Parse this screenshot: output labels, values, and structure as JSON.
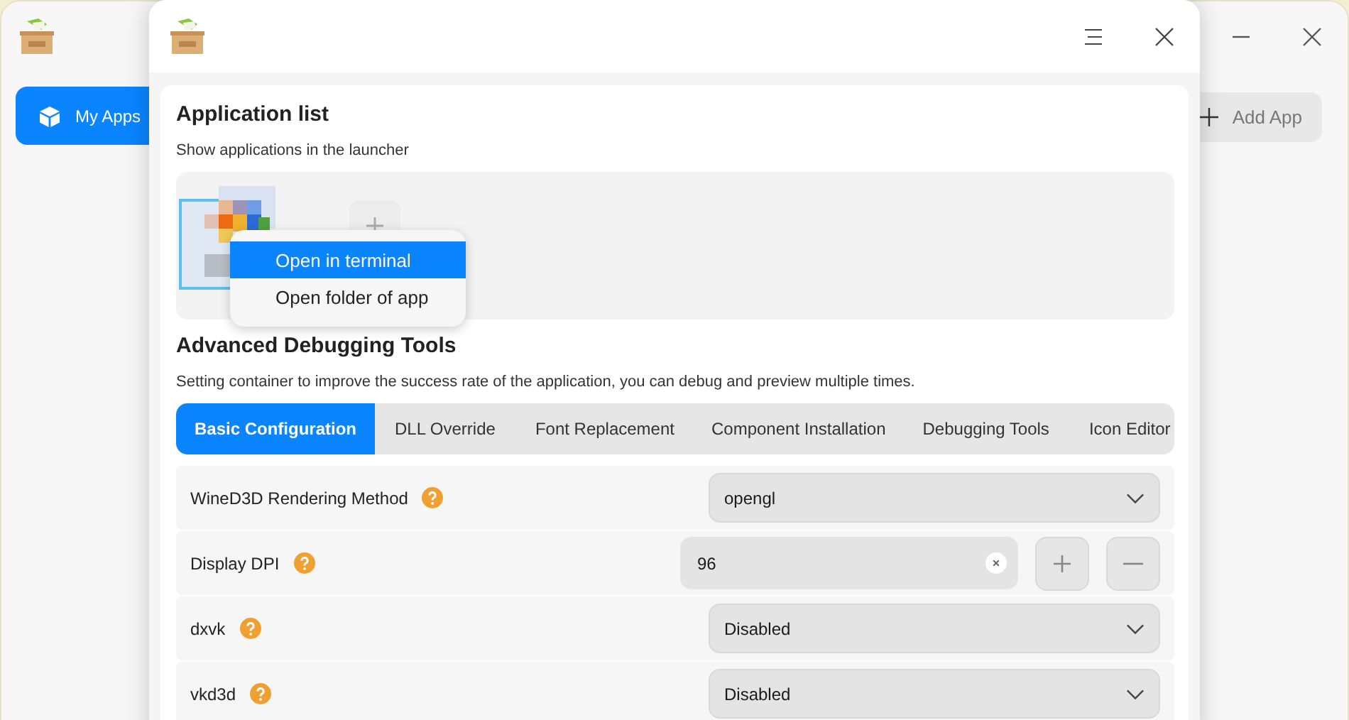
{
  "main_window": {
    "sidebar": {
      "items": [
        {
          "label": "My Apps",
          "selected": true
        }
      ]
    },
    "add_button": {
      "label": "Add App"
    }
  },
  "dialog": {
    "application_list": {
      "title": "Application list",
      "subtitle": "Show applications in the launcher"
    },
    "context_menu": {
      "items": [
        {
          "label": "Open in terminal",
          "selected": true
        },
        {
          "label": "Open folder of app",
          "selected": false
        }
      ]
    },
    "advanced": {
      "title": "Advanced Debugging Tools",
      "description": "Setting container to improve the success rate of the application, you can debug and preview multiple times."
    },
    "tabs": [
      {
        "label": "Basic Configuration",
        "selected": true
      },
      {
        "label": "DLL Override",
        "selected": false
      },
      {
        "label": "Font Replacement",
        "selected": false
      },
      {
        "label": "Component Installation",
        "selected": false
      },
      {
        "label": "Debugging Tools",
        "selected": false
      },
      {
        "label": "Icon Editor",
        "selected": false
      }
    ],
    "settings": [
      {
        "kind": "select",
        "label": "WineD3D Rendering Method",
        "value": "opengl"
      },
      {
        "kind": "spinbox",
        "label": "Display DPI",
        "value": "96"
      },
      {
        "kind": "select",
        "label": "dxvk",
        "value": "Disabled"
      },
      {
        "kind": "select",
        "label": "vkd3d",
        "value": "Disabled"
      }
    ]
  }
}
